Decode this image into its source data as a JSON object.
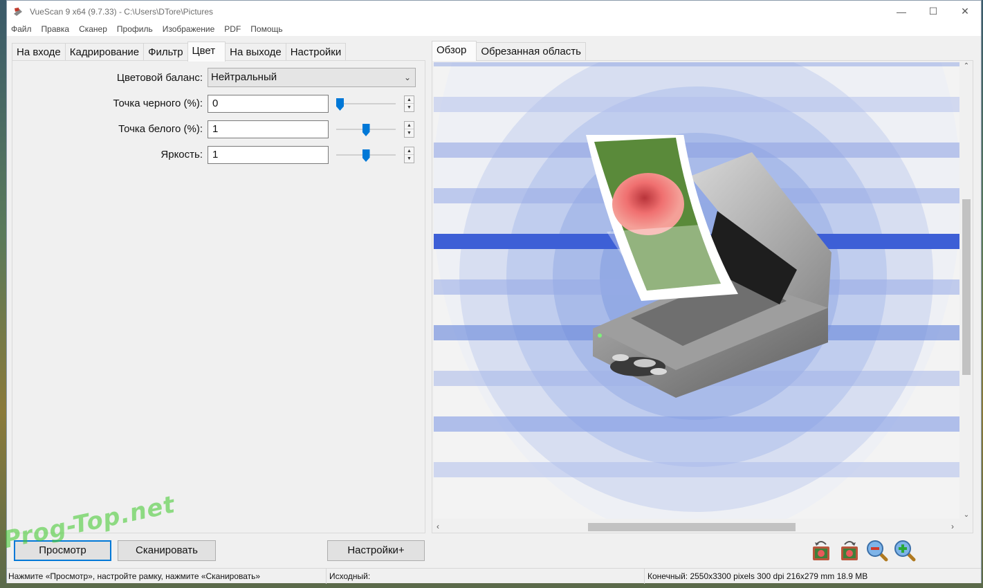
{
  "window": {
    "title": "VueScan 9 x64 (9.7.33) - C:\\Users\\DTore\\Pictures",
    "controls": {
      "minimize": "—",
      "maximize": "☐",
      "close": "✕"
    }
  },
  "menu": [
    "Файл",
    "Правка",
    "Сканер",
    "Профиль",
    "Изображение",
    "PDF",
    "Помощь"
  ],
  "left_tabs": [
    {
      "label": "На входе"
    },
    {
      "label": "Кадрирование"
    },
    {
      "label": "Фильтр"
    },
    {
      "label": "Цвет",
      "active": true
    },
    {
      "label": "На выходе"
    },
    {
      "label": "Настройки"
    }
  ],
  "color_settings": {
    "color_balance": {
      "label": "Цветовой баланс:",
      "value": "Нейтральный"
    },
    "black_point": {
      "label": "Точка черного (%):",
      "value": "0",
      "slider_level": 0.0
    },
    "white_point": {
      "label": "Точка белого (%):",
      "value": "1",
      "slider_level": 0.5
    },
    "brightness": {
      "label": "Яркость:",
      "value": "1",
      "slider_level": 0.5
    }
  },
  "right_tabs": [
    {
      "label": "Обзор",
      "active": true
    },
    {
      "label": "Обрезанная область"
    }
  ],
  "buttons": {
    "preview": "Просмотр",
    "scan": "Сканировать",
    "more_settings": "Настройки+"
  },
  "toolbar_icons": [
    "rotate-left-icon",
    "rotate-right-icon",
    "zoom-out-icon",
    "zoom-in-icon"
  ],
  "status": {
    "hint": "Нажмите «Просмотр», настройте рамку, нажмите «Сканировать»",
    "source": "Исходный:",
    "output": "Конечный: 2550x3300 pixels 300 dpi 216x279 mm 18.9 MB"
  },
  "watermark": "Prog-Top.net",
  "colors": {
    "accent": "#0078d7",
    "preview_ring": "#9fb3e8",
    "preview_stripe": "#3d5fd6",
    "watermark": "#3cc828"
  }
}
